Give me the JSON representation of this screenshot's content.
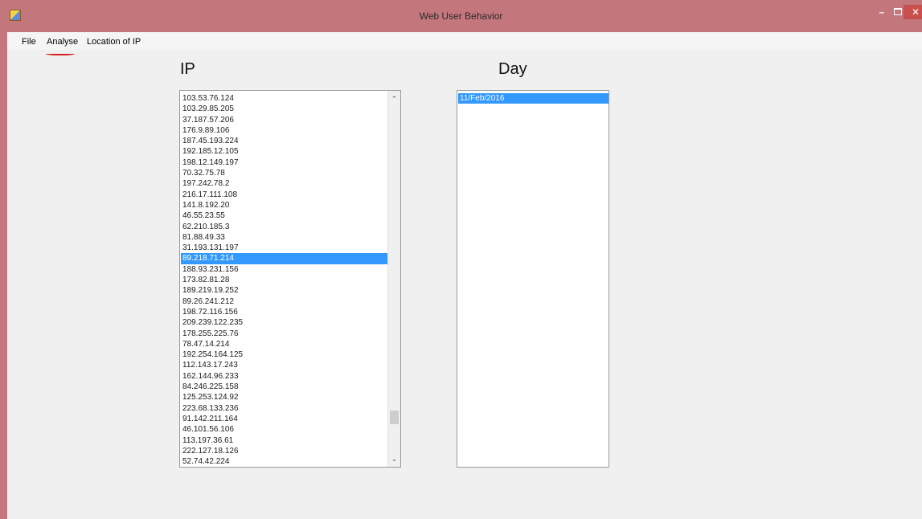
{
  "window": {
    "title": "Web User Behavior",
    "minimize": "–",
    "close": "✕"
  },
  "menu": {
    "file": "File",
    "analyse": "Analyse",
    "location": "Location of IP"
  },
  "ip_panel": {
    "heading": "IP",
    "items": [
      "103.53.76.124",
      "103.29.85.205",
      "37.187.57.206",
      "176.9.89.106",
      "187.45.193.224",
      "192.185.12.105",
      "198.12.149.197",
      "70.32.75.78",
      "197.242.78.2",
      "216.17.111.108",
      "141.8.192.20",
      "46.55.23.55",
      "62.210.185.3",
      "81.88.49.33",
      "31.193.131.197",
      "89.218.71.214",
      "188.93.231.156",
      "173.82.81.28",
      "189.219.19.252",
      "89.26.241.212",
      "198.72.116.156",
      "209.239.122.235",
      "178.255.225.76",
      "78.47.14.214",
      "192.254.164.125",
      "112.143.17.243",
      "162.144.96.233",
      "84.246.225.158",
      "125.253.124.92",
      "223.68.133.236",
      "91.142.211.164",
      "46.101.56.106",
      "113.197.36.61",
      "222.127.18.126",
      "52.74.42.224"
    ],
    "selected_index": 15,
    "scroll_up": "⌃",
    "scroll_down": "⌄"
  },
  "day_panel": {
    "heading": "Day",
    "items": [
      "11/Feb/2016"
    ],
    "selected_index": 0
  },
  "colors": {
    "titlebar": "#c4767d",
    "selection": "#3399ff",
    "close_button": "#c7504e"
  }
}
